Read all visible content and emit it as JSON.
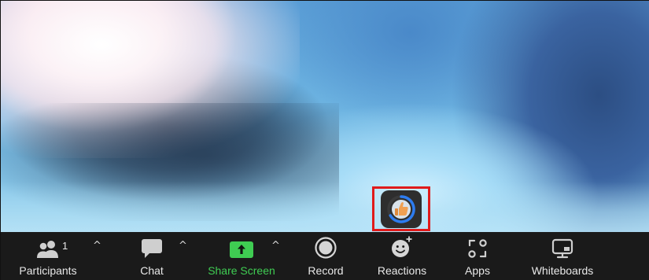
{
  "toolbar": {
    "participants": {
      "label": "Participants",
      "count": "1"
    },
    "chat": {
      "label": "Chat"
    },
    "share_screen": {
      "label": "Share Screen"
    },
    "record": {
      "label": "Record"
    },
    "reactions": {
      "label": "Reactions"
    },
    "apps": {
      "label": "Apps"
    },
    "whiteboards": {
      "label": "Whiteboards"
    }
  },
  "caret_glyph": "^",
  "colors": {
    "toolbar_bg": "#1a1a1a",
    "share_green": "#3fcc52",
    "highlight_red": "#e01b1b",
    "ring_blue": "#2d7cf0"
  },
  "icons": {
    "participants": "participants-icon",
    "chat": "chat-icon",
    "share_screen": "share-screen-icon",
    "record": "record-icon",
    "reactions": "reactions-icon",
    "apps": "apps-icon",
    "whiteboards": "whiteboards-icon",
    "reaction": "thumbs-up-reaction-icon"
  }
}
